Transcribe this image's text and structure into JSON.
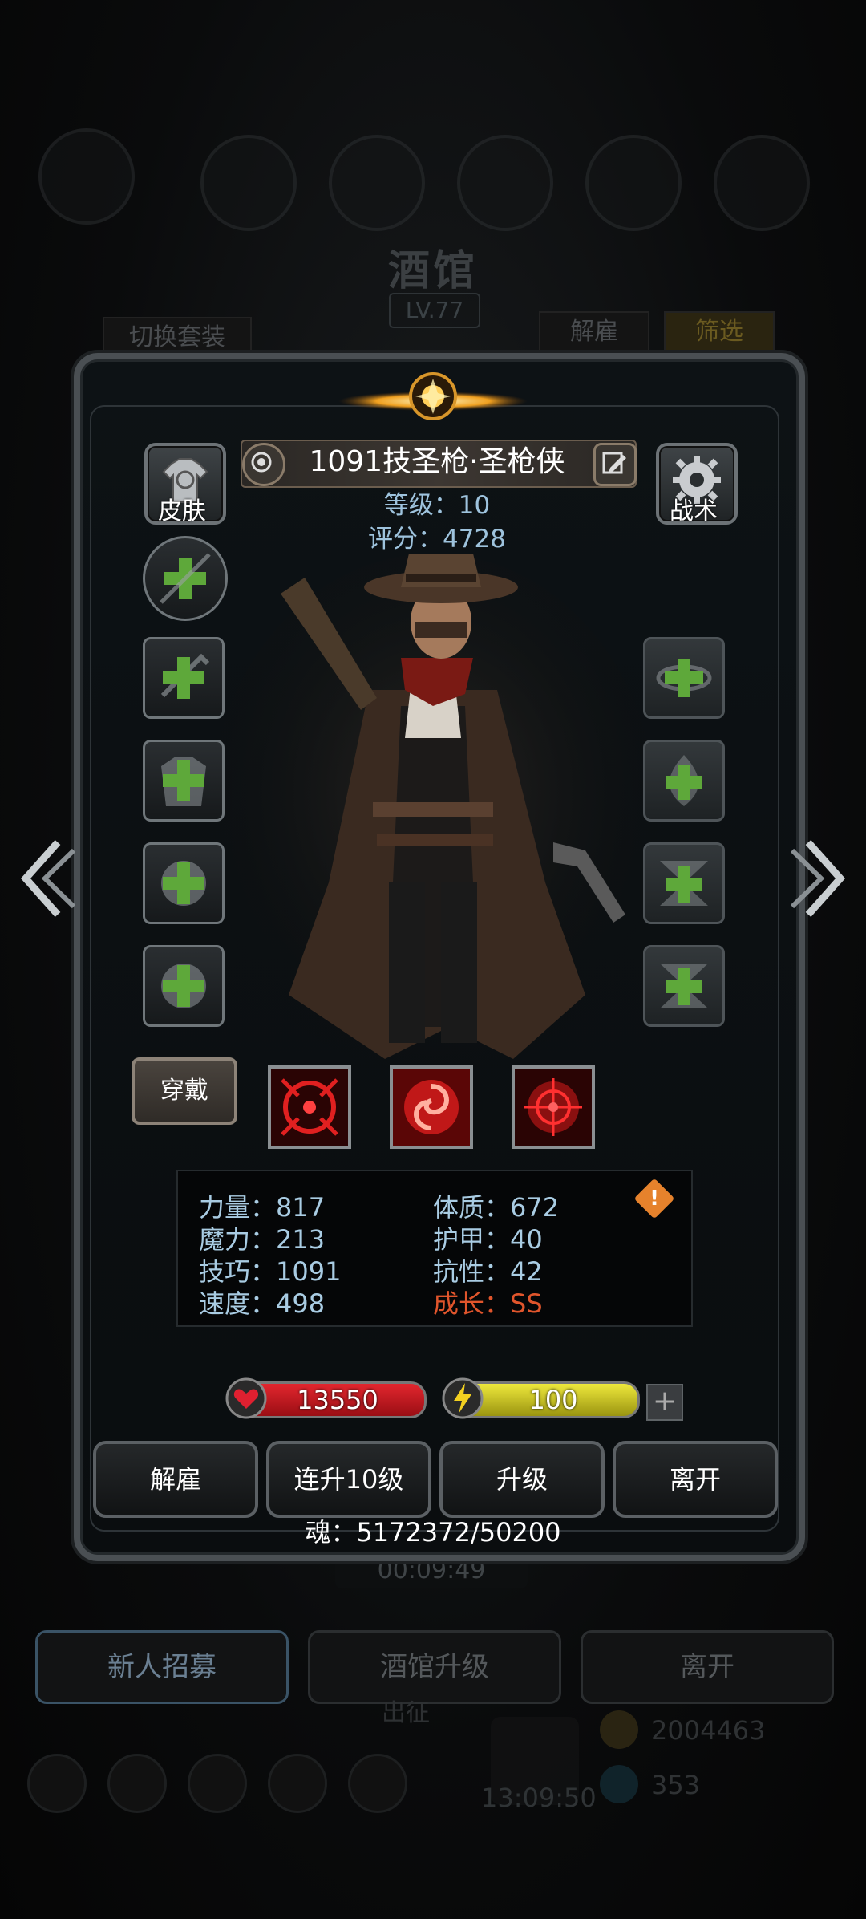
{
  "background": {
    "title": "酒馆",
    "level": "LV.77",
    "switch_outfit": "切换套装",
    "dismiss": "解雇",
    "filter": "筛选",
    "timer": "00:09:49",
    "bottom_buttons": [
      "新人招募",
      "酒馆升级",
      "离开"
    ],
    "expedition": "出征",
    "gold": "2004463",
    "gems": "353",
    "clock": "13:09:50"
  },
  "hero": {
    "name": "1091技圣枪·圣枪侠",
    "level_label": "等级：10",
    "score_label": "评分：4728",
    "skin_label": "皮肤",
    "tactics_label": "战术",
    "wear_label": "穿戴"
  },
  "stats": {
    "left": [
      "力量：817",
      "魔力：213",
      "技巧：1091",
      "速度：498"
    ],
    "right": [
      "体质：672",
      "护甲：40",
      "抗性：42"
    ],
    "growth": "成长：SS",
    "warn_symbol": "!"
  },
  "bars": {
    "hp": "13550",
    "energy": "100",
    "plus": "+"
  },
  "actions": [
    "解雇",
    "连升10级",
    "升级",
    "离开"
  ],
  "soul": "魂：5172372/50200",
  "colors": {
    "accent_blue": "#9ec3dd",
    "growth_red": "#e0552c",
    "hp_red": "#c4121b",
    "energy_yellow": "#d8d21a"
  }
}
